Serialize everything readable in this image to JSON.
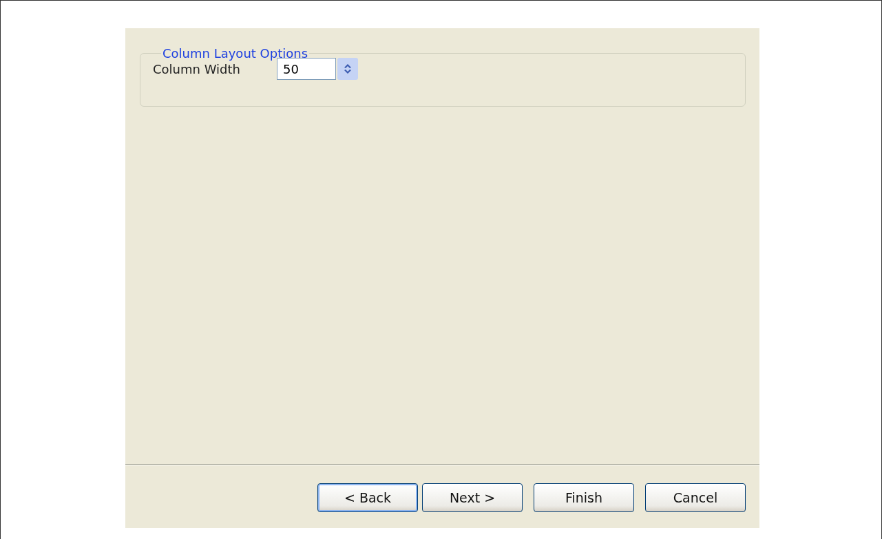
{
  "group": {
    "title": "Column Layout Options",
    "field": {
      "label": "Column Width",
      "value": "50"
    }
  },
  "buttons": [
    {
      "label": "< Back",
      "focused": true
    },
    {
      "label": "Next >",
      "focused": false
    },
    {
      "label": "Finish",
      "focused": false
    },
    {
      "label": "Cancel",
      "focused": false
    }
  ]
}
